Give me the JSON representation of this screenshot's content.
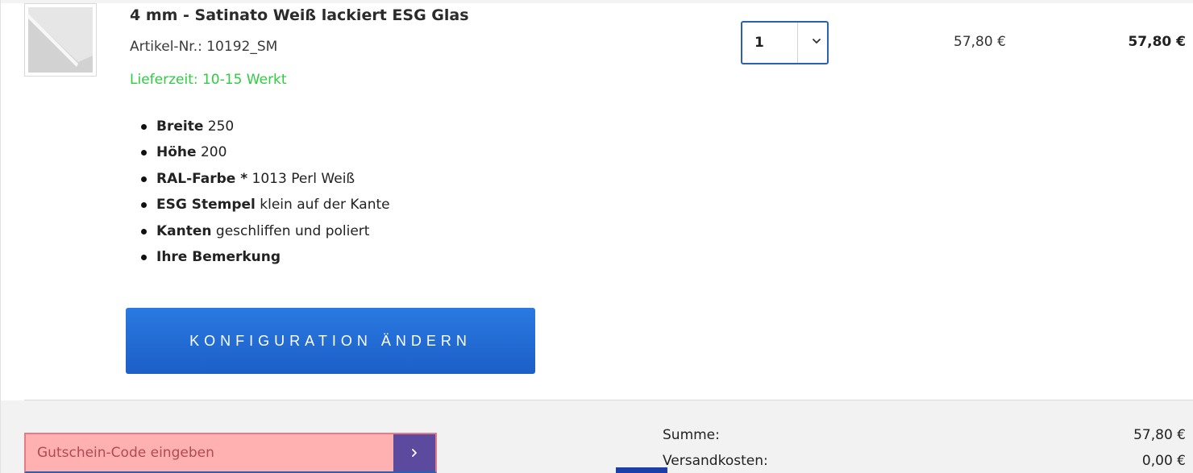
{
  "product": {
    "title": "4 mm - Satinato Weiß lackiert ESG Glas",
    "article_number": "Artikel-Nr.: 10192_SM",
    "delivery_time": "Lieferzeit: 10-15 Werkt",
    "image_icon": "glass-sheet-thumbnail",
    "attributes": [
      {
        "name": "Breite",
        "value": "250"
      },
      {
        "name": "Höhe",
        "value": "200"
      },
      {
        "name": "RAL-Farbe *",
        "value": "1013 Perl Weiß"
      },
      {
        "name": "ESG Stempel",
        "value": "klein auf der Kante"
      },
      {
        "name": "Kanten",
        "value": "geschliffen und poliert"
      },
      {
        "name": "Ihre Bemerkung",
        "value": ""
      }
    ],
    "configure_button_label": "KONFIGURATION ÄNDERN",
    "quantity": "1",
    "quantity_icon": "chevron-down-icon",
    "unit_price": "57,80 €",
    "total_price": "57,80 €"
  },
  "footer": {
    "coupon_placeholder": "Gutschein-Code eingeben",
    "coupon_submit_icon": "chevron-right-icon",
    "summary": {
      "subtotal_label": "Summe:",
      "subtotal_value": "57,80 €",
      "shipping_label": "Versandkosten:",
      "shipping_value": "0,00 €"
    }
  },
  "colors": {
    "accent_blue": "#1c5fc7",
    "delivery_green": "#2ecc40",
    "coupon_bg": "#ffb0b0",
    "coupon_button": "#5b4a9e"
  }
}
